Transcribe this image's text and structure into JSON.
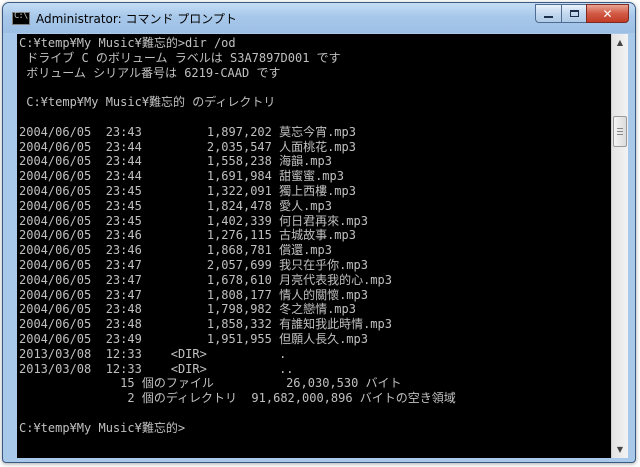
{
  "window": {
    "title": "Administrator: コマンド プロンプト",
    "icon": "cmd-window-icon",
    "icon_text": "C:\\",
    "buttons": {
      "minimize": "minimize-icon",
      "maximize": "maximize-icon",
      "close_glyph": "✕"
    }
  },
  "console": {
    "lines": [
      "C:¥temp¥My Music¥難忘的>dir /od",
      " ドライブ C のボリューム ラベルは S3A7897D001 です",
      " ボリューム シリアル番号は 6219-CAAD です",
      "",
      " C:¥temp¥My Music¥難忘的 のディレクトリ",
      "",
      "2004/06/05  23:43         1,897,202 莫忘今宵.mp3",
      "2004/06/05  23:44         2,035,547 人面桃花.mp3",
      "2004/06/05  23:44         1,558,238 海韻.mp3",
      "2004/06/05  23:44         1,691,984 甜蜜蜜.mp3",
      "2004/06/05  23:45         1,322,091 獨上西樓.mp3",
      "2004/06/05  23:45         1,824,478 愛人.mp3",
      "2004/06/05  23:45         1,402,339 何日君再來.mp3",
      "2004/06/05  23:46         1,276,115 古城故事.mp3",
      "2004/06/05  23:46         1,868,781 償還.mp3",
      "2004/06/05  23:47         2,057,699 我只在乎你.mp3",
      "2004/06/05  23:47         1,678,610 月亮代表我的心.mp3",
      "2004/06/05  23:47         1,808,177 情人的關懷.mp3",
      "2004/06/05  23:48         1,798,982 冬之戀情.mp3",
      "2004/06/05  23:48         1,858,332 有誰知我此時情.mp3",
      "2004/06/05  23:49         1,951,955 但願人長久.mp3",
      "2013/03/08  12:33    <DIR>          .",
      "2013/03/08  12:33    <DIR>          ..",
      "              15 個のファイル          26,030,530 バイト",
      "               2 個のディレクトリ  91,682,000,896 バイトの空き領域",
      "",
      "C:¥temp¥My Music¥難忘的>"
    ]
  },
  "scrollbar": {
    "up_arrow": "▲",
    "down_arrow": "▼",
    "position_fraction": 0.18
  }
}
